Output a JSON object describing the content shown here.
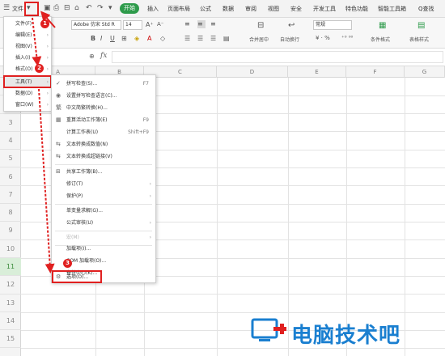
{
  "menubar": {
    "file_label": "文件",
    "start_tab": "开始",
    "tabs": [
      "插入",
      "页面布局",
      "公式",
      "数据",
      "审阅",
      "视图",
      "安全",
      "开发工具",
      "特色功能",
      "智能工具箱"
    ],
    "search_label": "Q查找"
  },
  "ribbon": {
    "font_name": "Adobe 仿宋 Std R",
    "font_size": "14",
    "number_format": "常规",
    "merge_label": "合并居中",
    "wrap_label": "自动换行",
    "cond_format_label": "条件格式",
    "table_style_label": "表格样式"
  },
  "formula_bar": {
    "fx_label": "fx"
  },
  "grid": {
    "columns": [
      "A",
      "B",
      "C",
      "D",
      "E",
      "F",
      "G"
    ],
    "rows": [
      "1",
      "2",
      "3",
      "4",
      "5",
      "6",
      "7",
      "8",
      "9",
      "10",
      "11",
      "12",
      "13",
      "14",
      "15"
    ],
    "selected_row": "11"
  },
  "file_menu": {
    "items": [
      {
        "label": "文件(F)",
        "arrow": "›"
      },
      {
        "label": "编辑(E)",
        "arrow": "›"
      },
      {
        "label": "视图(V)",
        "arrow": "›"
      },
      {
        "label": "插入(I)",
        "arrow": "›"
      },
      {
        "label": "格式(O)",
        "arrow": "›"
      },
      {
        "label": "工具(T)",
        "arrow": "›"
      },
      {
        "label": "数据(D)",
        "arrow": "›"
      },
      {
        "label": "窗口(W)",
        "arrow": "›"
      }
    ]
  },
  "tools_menu": {
    "items": [
      {
        "label": "拼写检查(S)...",
        "shortcut": "F7",
        "icon": "spellcheck-icon"
      },
      {
        "label": "设置拼写检查语言(C)...",
        "shortcut": "",
        "icon": "language-icon"
      },
      {
        "label": "中文简繁转换(H)...",
        "shortcut": "",
        "icon": "chinese-convert-icon"
      },
      {
        "label": "重算活动工作簿(E)",
        "shortcut": "F9",
        "icon": "recalc-icon"
      },
      {
        "label": "计算工作表(U)",
        "shortcut": "Shift+F9",
        "icon": ""
      },
      {
        "label": "文本转换成数值(N)",
        "shortcut": "",
        "icon": "text-to-number-icon"
      },
      {
        "label": "文本转换成超链接(V)",
        "shortcut": "",
        "icon": "hyperlink-icon"
      },
      {
        "label": "共享工作簿(B)...",
        "shortcut": "",
        "icon": "share-icon"
      },
      {
        "label": "修订(T)",
        "shortcut": "",
        "icon": "",
        "submenu": true
      },
      {
        "label": "保护(P)",
        "shortcut": "",
        "icon": "",
        "submenu": true
      },
      {
        "label": "单变量求解(G)...",
        "shortcut": "",
        "icon": ""
      },
      {
        "label": "公式审核(U)",
        "shortcut": "",
        "icon": "",
        "submenu": true
      },
      {
        "label": "宏(M)",
        "shortcut": "",
        "icon": "",
        "submenu": true,
        "disabled": true
      },
      {
        "label": "加载项(I)...",
        "shortcut": "",
        "icon": ""
      },
      {
        "label": "COM 加载项(O)...",
        "shortcut": "",
        "icon": ""
      },
      {
        "label": "备份中心(K)...",
        "shortcut": "",
        "icon": ""
      },
      {
        "label": "选项(O)...",
        "shortcut": "",
        "icon": "gear-icon"
      }
    ]
  },
  "annotations": {
    "step1": "1",
    "step2": "2",
    "step3": "3"
  },
  "watermark": {
    "text": "电脑技术吧"
  },
  "colors": {
    "accent_green": "#2e9b4b",
    "annotation_red": "#e02020",
    "watermark_blue": "#1a7fd0"
  }
}
